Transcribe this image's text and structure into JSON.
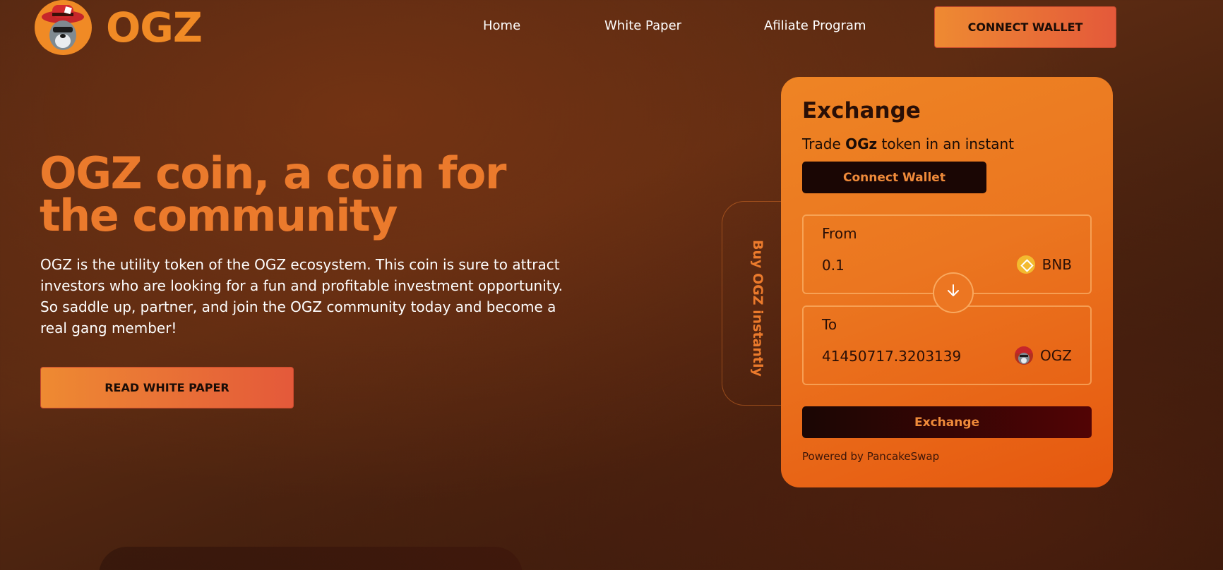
{
  "brand": {
    "name": "OGZ"
  },
  "nav": {
    "items": [
      {
        "label": "Home"
      },
      {
        "label": "White Paper"
      },
      {
        "label": "Afiliate Program"
      }
    ],
    "connect_label": "CONNECT WALLET"
  },
  "hero": {
    "title": "OGZ coin, a coin for the community",
    "description": "OGZ is the utility token of the OGZ ecosystem. This coin is sure to attract investors who are looking for a fun and profitable investment opportunity. So saddle up, partner, and join the OGZ community today and become a real gang member!",
    "cta_label": "READ WHITE PAPER"
  },
  "side_tab": {
    "label": "Buy OGZ instantly"
  },
  "exchange": {
    "title": "Exchange",
    "subtitle_prefix": "Trade ",
    "subtitle_bold": "OGz",
    "subtitle_suffix": " token in an instant",
    "connect_label": "Connect Wallet",
    "from": {
      "label": "From",
      "value": "0.1",
      "token": "BNB"
    },
    "to": {
      "label": "To",
      "value": "41450717.3203139",
      "token": "OGZ"
    },
    "exchange_label": "Exchange",
    "powered_by": "Powered by PancakeSwap"
  },
  "colors": {
    "accent": "#eb7a2c",
    "button_gradient_start": "#ee8a32",
    "button_gradient_end": "#e4593a",
    "card": "#eb7620",
    "dark_button": "#1a0604",
    "bnb": "#f3ba2f"
  },
  "icons": {
    "logo": "cowboy-mascot-icon",
    "swap": "arrow-down-icon",
    "from_token": "bnb-icon",
    "to_token": "ogz-mascot-icon"
  }
}
